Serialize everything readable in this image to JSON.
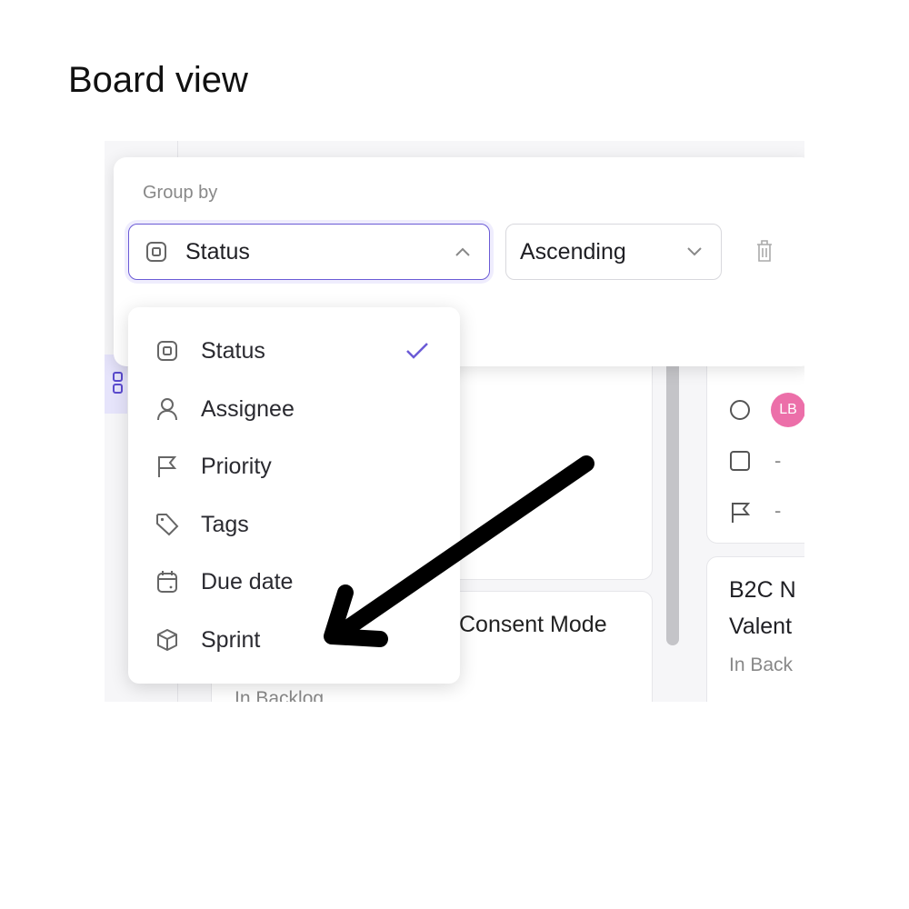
{
  "title": "Board view",
  "popover": {
    "label": "Group by",
    "group_select": {
      "value": "Status",
      "icon": "status-square-icon",
      "state": "open"
    },
    "order_select": {
      "value": "Ascending"
    },
    "delete_icon": "trash-icon"
  },
  "menu": {
    "items": [
      {
        "label": "Status",
        "icon": "status-square-icon",
        "selected": true
      },
      {
        "label": "Assignee",
        "icon": "person-icon"
      },
      {
        "label": "Priority",
        "icon": "flag-icon"
      },
      {
        "label": "Tags",
        "icon": "tag-icon"
      },
      {
        "label": "Due date",
        "icon": "calendar-icon"
      },
      {
        "label": "Sprint",
        "icon": "cube-icon"
      }
    ]
  },
  "background": {
    "card_title_fragment": "Consent Mode",
    "card_status": "In Backlog",
    "right_card": {
      "avatar": "LB",
      "due": "-",
      "priority": "-"
    },
    "right_card2": {
      "title_line1": "B2C N",
      "title_line2": "Valent",
      "status": "In Back"
    }
  },
  "colors": {
    "accent": "#6b5bd6",
    "avatar": "#ec6fa9",
    "annotation_arrow": "#000000"
  }
}
